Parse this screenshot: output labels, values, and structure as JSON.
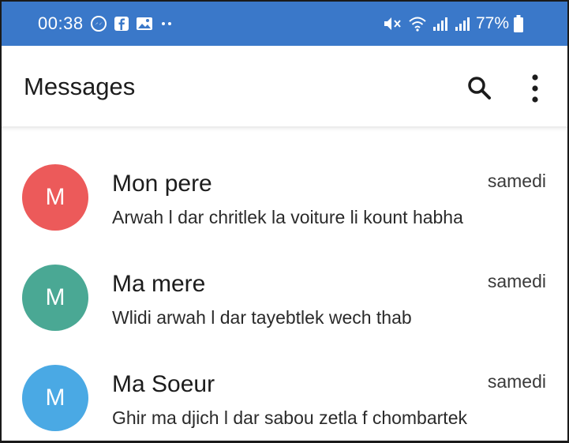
{
  "status_bar": {
    "time": "00:38",
    "battery": "77%",
    "left_icons": [
      "messenger-icon",
      "facebook-icon",
      "gallery-icon",
      "more-dots-icon"
    ],
    "right_icons": [
      "mute-icon",
      "wifi-icon",
      "signal-icon",
      "signal-icon",
      "battery-icon"
    ],
    "bg_color": "#3a78c9"
  },
  "header": {
    "title": "Messages",
    "actions": [
      "search-icon",
      "more-vert-icon"
    ]
  },
  "conversations": [
    {
      "avatar_letter": "M",
      "avatar_color": "#ec5a5a",
      "name": "Mon pere",
      "time": "samedi",
      "preview": "Arwah l dar chritlek la voiture li kount habha"
    },
    {
      "avatar_letter": "M",
      "avatar_color": "#4aa894",
      "name": "Ma mere",
      "time": "samedi",
      "preview": "Wlidi arwah l dar tayebtlek wech thab"
    },
    {
      "avatar_letter": "M",
      "avatar_color": "#4aa9e4",
      "name": "Ma Soeur",
      "time": "samedi",
      "preview": "Ghir ma djich l dar sabou zetla f chombartek"
    }
  ]
}
